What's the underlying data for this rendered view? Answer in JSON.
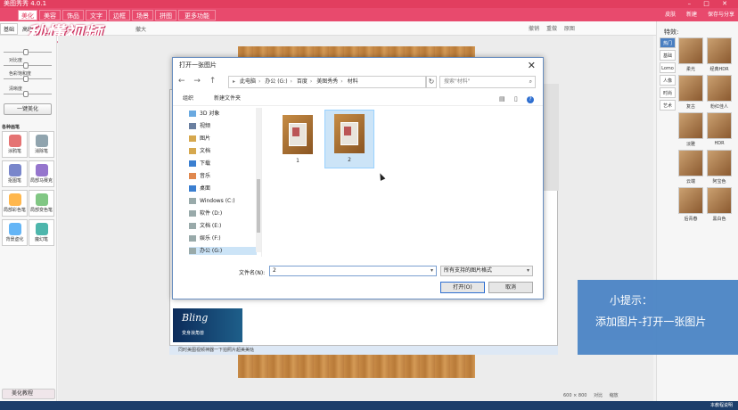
{
  "app": {
    "title": "美图秀秀 4.0.1"
  },
  "menu": {
    "tabs": [
      "美化",
      "美容",
      "饰品",
      "文字",
      "边框",
      "场景",
      "拼图",
      "更多功能"
    ],
    "active_tab": "美化",
    "right": [
      "皮肤",
      "新建",
      "保存与分享"
    ]
  },
  "toolbar": {
    "subtabs": [
      "基础",
      "高级"
    ],
    "extra": "撤大",
    "mid": [
      "撤销",
      "重做",
      "原图"
    ],
    "right": [
      "旋转",
      "裁剪",
      "尺寸"
    ]
  },
  "watermark": "秒懂视频",
  "left_panel": {
    "sliders": [
      {
        "label": "对比度",
        "level": 0.45
      },
      {
        "label": "色彩饱和度",
        "level": 0.45
      },
      {
        "label": "清晰度",
        "level": 0.45
      }
    ],
    "one_click_label": "一键美化",
    "section_title": "各种画笔",
    "tools": [
      "涂鸦笔",
      "消除笔",
      "抠图笔",
      "局部马赛克",
      "局部彩色笔",
      "局部变色笔",
      "背景虚化",
      "魔幻笔"
    ],
    "tutorial_label": "美化教程"
  },
  "right_panel": {
    "title": "特效:",
    "tabs": [
      "热门",
      "基础",
      "Lomo",
      "人像",
      "时尚",
      "艺术"
    ],
    "active_tab": "热门",
    "effects": [
      "柔光",
      "经典HDR",
      "复古",
      "粉红佳人",
      "淡雅",
      "HDR",
      "云端",
      "阿宝色",
      "后青春",
      "黑白色"
    ]
  },
  "dialog": {
    "title": "打开一张图片",
    "breadcrumb": [
      "此电脑",
      "办公 (G:)",
      "百度",
      "美图秀秀",
      "材料"
    ],
    "search_placeholder": "搜索\"材料\"",
    "organize_label": "组织",
    "new_folder_label": "新建文件夹",
    "tree": [
      "3D 对象",
      "视频",
      "图片",
      "文档",
      "下载",
      "音乐",
      "桌面",
      "Windows (C:)",
      "软件 (D:)",
      "文档 (E:)",
      "娱乐 (F:)",
      "办公 (G:)"
    ],
    "tree_selected": "办公 (G:)",
    "files": [
      "1",
      "2"
    ],
    "selected_file": "2",
    "filename_label": "文件名(N):",
    "filename_value": "2",
    "filetype_value": "所有支持的图片格式",
    "open_button": "打开(O)",
    "cancel_button": "取消"
  },
  "background_window": {
    "banner_big": "Bling",
    "banner_small": "变身浪角兽",
    "status_text": "同时美图视频神器一下拍照片超美美哒"
  },
  "zoom": {
    "size": "600 × 800",
    "compare": "对比",
    "fit": "缩放"
  },
  "tip": {
    "line1": "小提示：",
    "line2": "添加图片-打开一张图片"
  },
  "status": {
    "right": "本教程说明"
  },
  "colors": {
    "brand": "#e84a6d",
    "tip_bg": "#4d86c6",
    "selection": "#cce4f7"
  }
}
